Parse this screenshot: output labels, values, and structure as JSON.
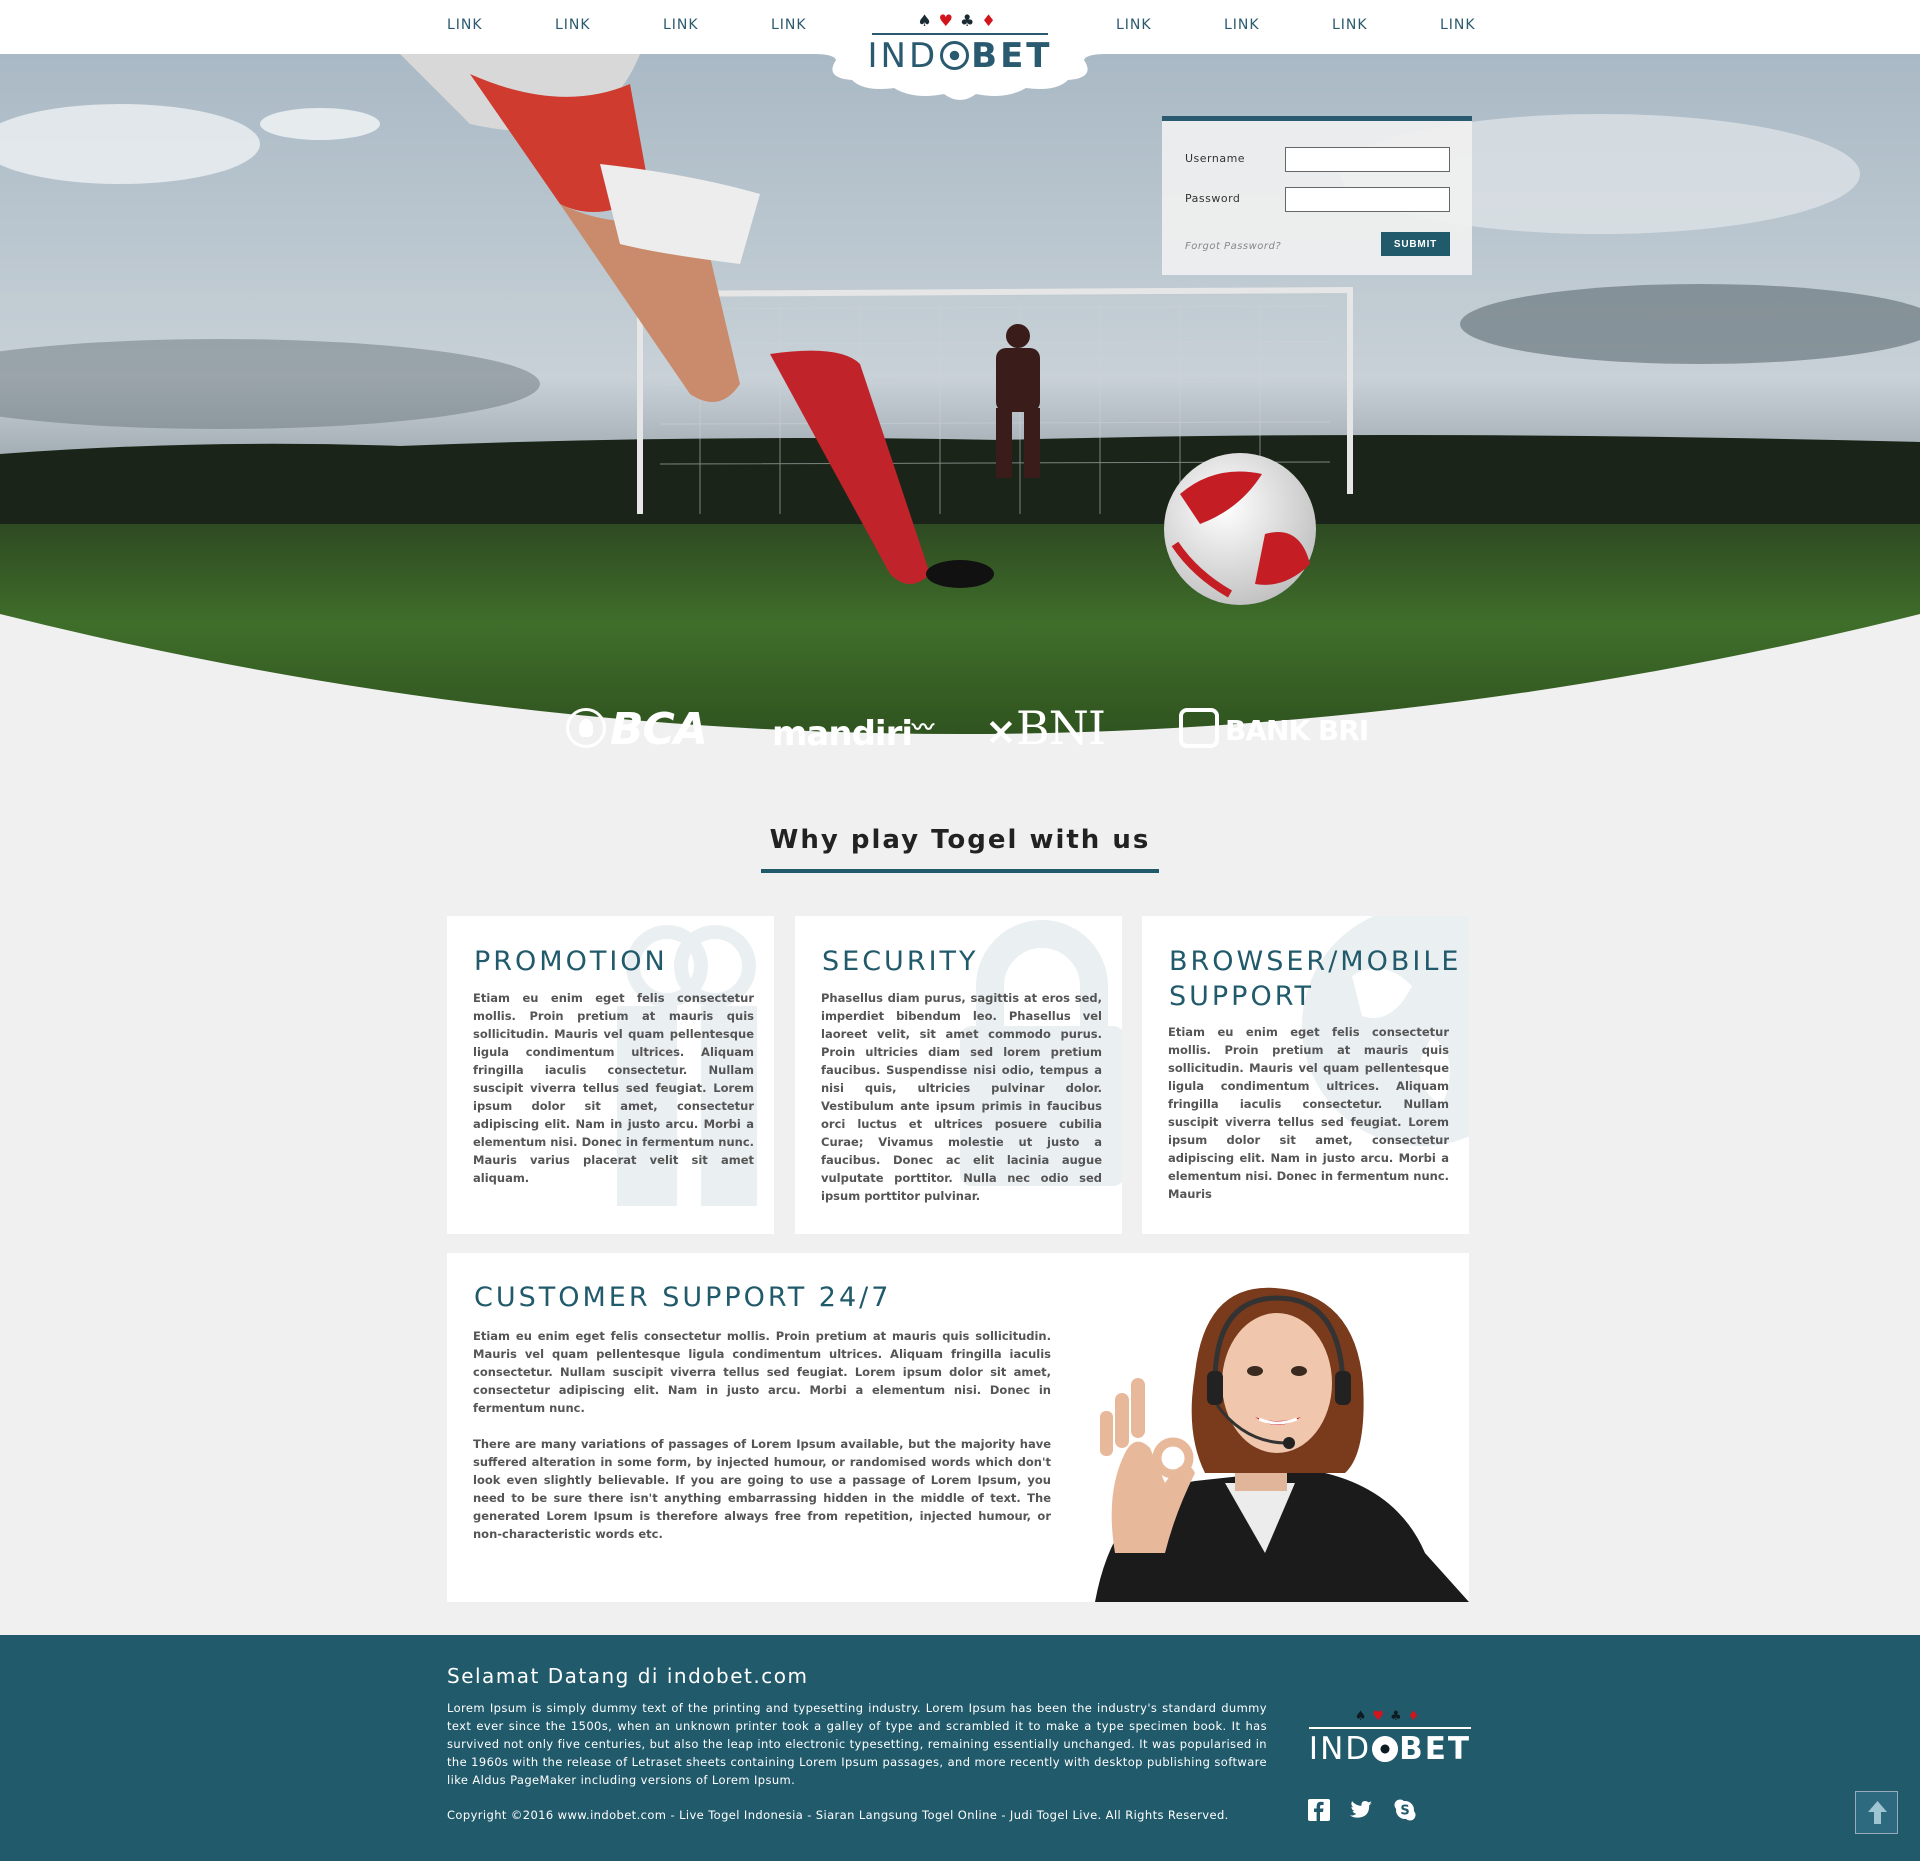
{
  "nav": {
    "links_left": [
      "LINK",
      "LINK",
      "LINK",
      "LINK"
    ],
    "links_right": [
      "LINK",
      "LINK",
      "LINK",
      "LINK"
    ]
  },
  "brand": {
    "suits": [
      "♠",
      "♥",
      "♣",
      "♦"
    ],
    "name_left": "IND",
    "name_right": "BET"
  },
  "login": {
    "username_label": "Username",
    "password_label": "Password",
    "username_value": "",
    "password_value": "",
    "forgot_label": "Forgot Password?",
    "submit_label": "SUBMIT"
  },
  "banks": [
    "BCA",
    "mandiri",
    "BNI",
    "BANK BRI"
  ],
  "why": {
    "title": "Why play Togel with us"
  },
  "cards": [
    {
      "title": "PROMOTION",
      "text": "Etiam eu enim eget felis consectetur mollis. Proin pretium at mauris quis sollicitudin. Mauris vel quam pellentesque ligula condimentum ultrices. Aliquam fringilla iaculis consectetur. Nullam suscipit viverra tellus sed feugiat. Lorem ipsum dolor sit amet, consectetur adipiscing elit. Nam in justo arcu. Morbi a elementum nisi. Donec in fermentum nunc. Mauris varius placerat velit sit amet aliquam."
    },
    {
      "title": "SECURITY",
      "text": "Phasellus diam purus, sagittis at eros sed, imperdiet bibendum leo. Phasellus vel laoreet velit, sit amet commodo purus. Proin ultricies diam sed lorem pretium faucibus. Suspendisse nisi odio, tempus a nisi quis, ultricies pulvinar dolor. Vestibulum ante ipsum primis in faucibus orci luctus et ultrices posuere cubilia Curae; Vivamus molestie ut justo a faucibus. Donec ac elit lacinia augue vulputate porttitor. Nulla nec odio sed ipsum porttitor pulvinar."
    },
    {
      "title": "BROWSER/MOBILE SUPPORT",
      "text": "Etiam eu enim eget felis consectetur mollis. Proin pretium at mauris quis sollicitudin. Mauris vel quam pellentesque ligula condimentum ultrices. Aliquam fringilla iaculis consectetur. Nullam suscipit viverra tellus sed feugiat. Lorem ipsum dolor sit amet, consectetur adipiscing elit. Nam in justo arcu. Morbi a elementum nisi. Donec in fermentum nunc. Mauris"
    }
  ],
  "support": {
    "title": "CUSTOMER SUPPORT 24/7",
    "paragraph1": "Etiam eu enim eget felis consectetur mollis. Proin pretium at mauris quis sollicitudin. Mauris vel quam pellentesque ligula condimentum ultrices. Aliquam fringilla iaculis consectetur. Nullam suscipit viverra tellus sed feugiat. Lorem ipsum dolor sit amet, consectetur adipiscing elit. Nam in justo arcu. Morbi a elementum nisi. Donec in fermentum nunc.",
    "paragraph2": "There are many variations of passages of Lorem Ipsum available, but the majority have suffered alteration in some form, by injected humour, or randomised words which don't look even slightly believable. If you are going to use a passage of Lorem Ipsum, you need to be sure there isn't anything embarrassing hidden in the middle of text. The generated Lorem Ipsum is therefore always free from repetition, injected humour, or non-characteristic words etc."
  },
  "footer": {
    "heading": "Selamat Datang di indobet.com",
    "text": "Lorem Ipsum is simply dummy text of the printing and typesetting industry. Lorem Ipsum has been the industry's standard dummy text ever since the 1500s, when an unknown printer took a galley of type and scrambled it to make a type specimen book. It has survived not only five centuries, but also the leap into electronic typesetting, remaining essentially unchanged. It was popularised in the 1960s with the release of Letraset sheets containing Lorem Ipsum passages, and more recently with desktop publishing software like Aldus PageMaker including versions of Lorem Ipsum.",
    "copyright": "Copyright ©2016 www.indobet.com - Live Togel Indonesia - Siaran Langsung Togel Online - Judi Togel Live. All Rights Reserved.",
    "social_icons": [
      "facebook-icon",
      "twitter-icon",
      "skype-icon"
    ]
  },
  "colors": {
    "brand": "#215a6b",
    "accent_red": "#d2141c",
    "page_bg": "#f0f0f0"
  }
}
